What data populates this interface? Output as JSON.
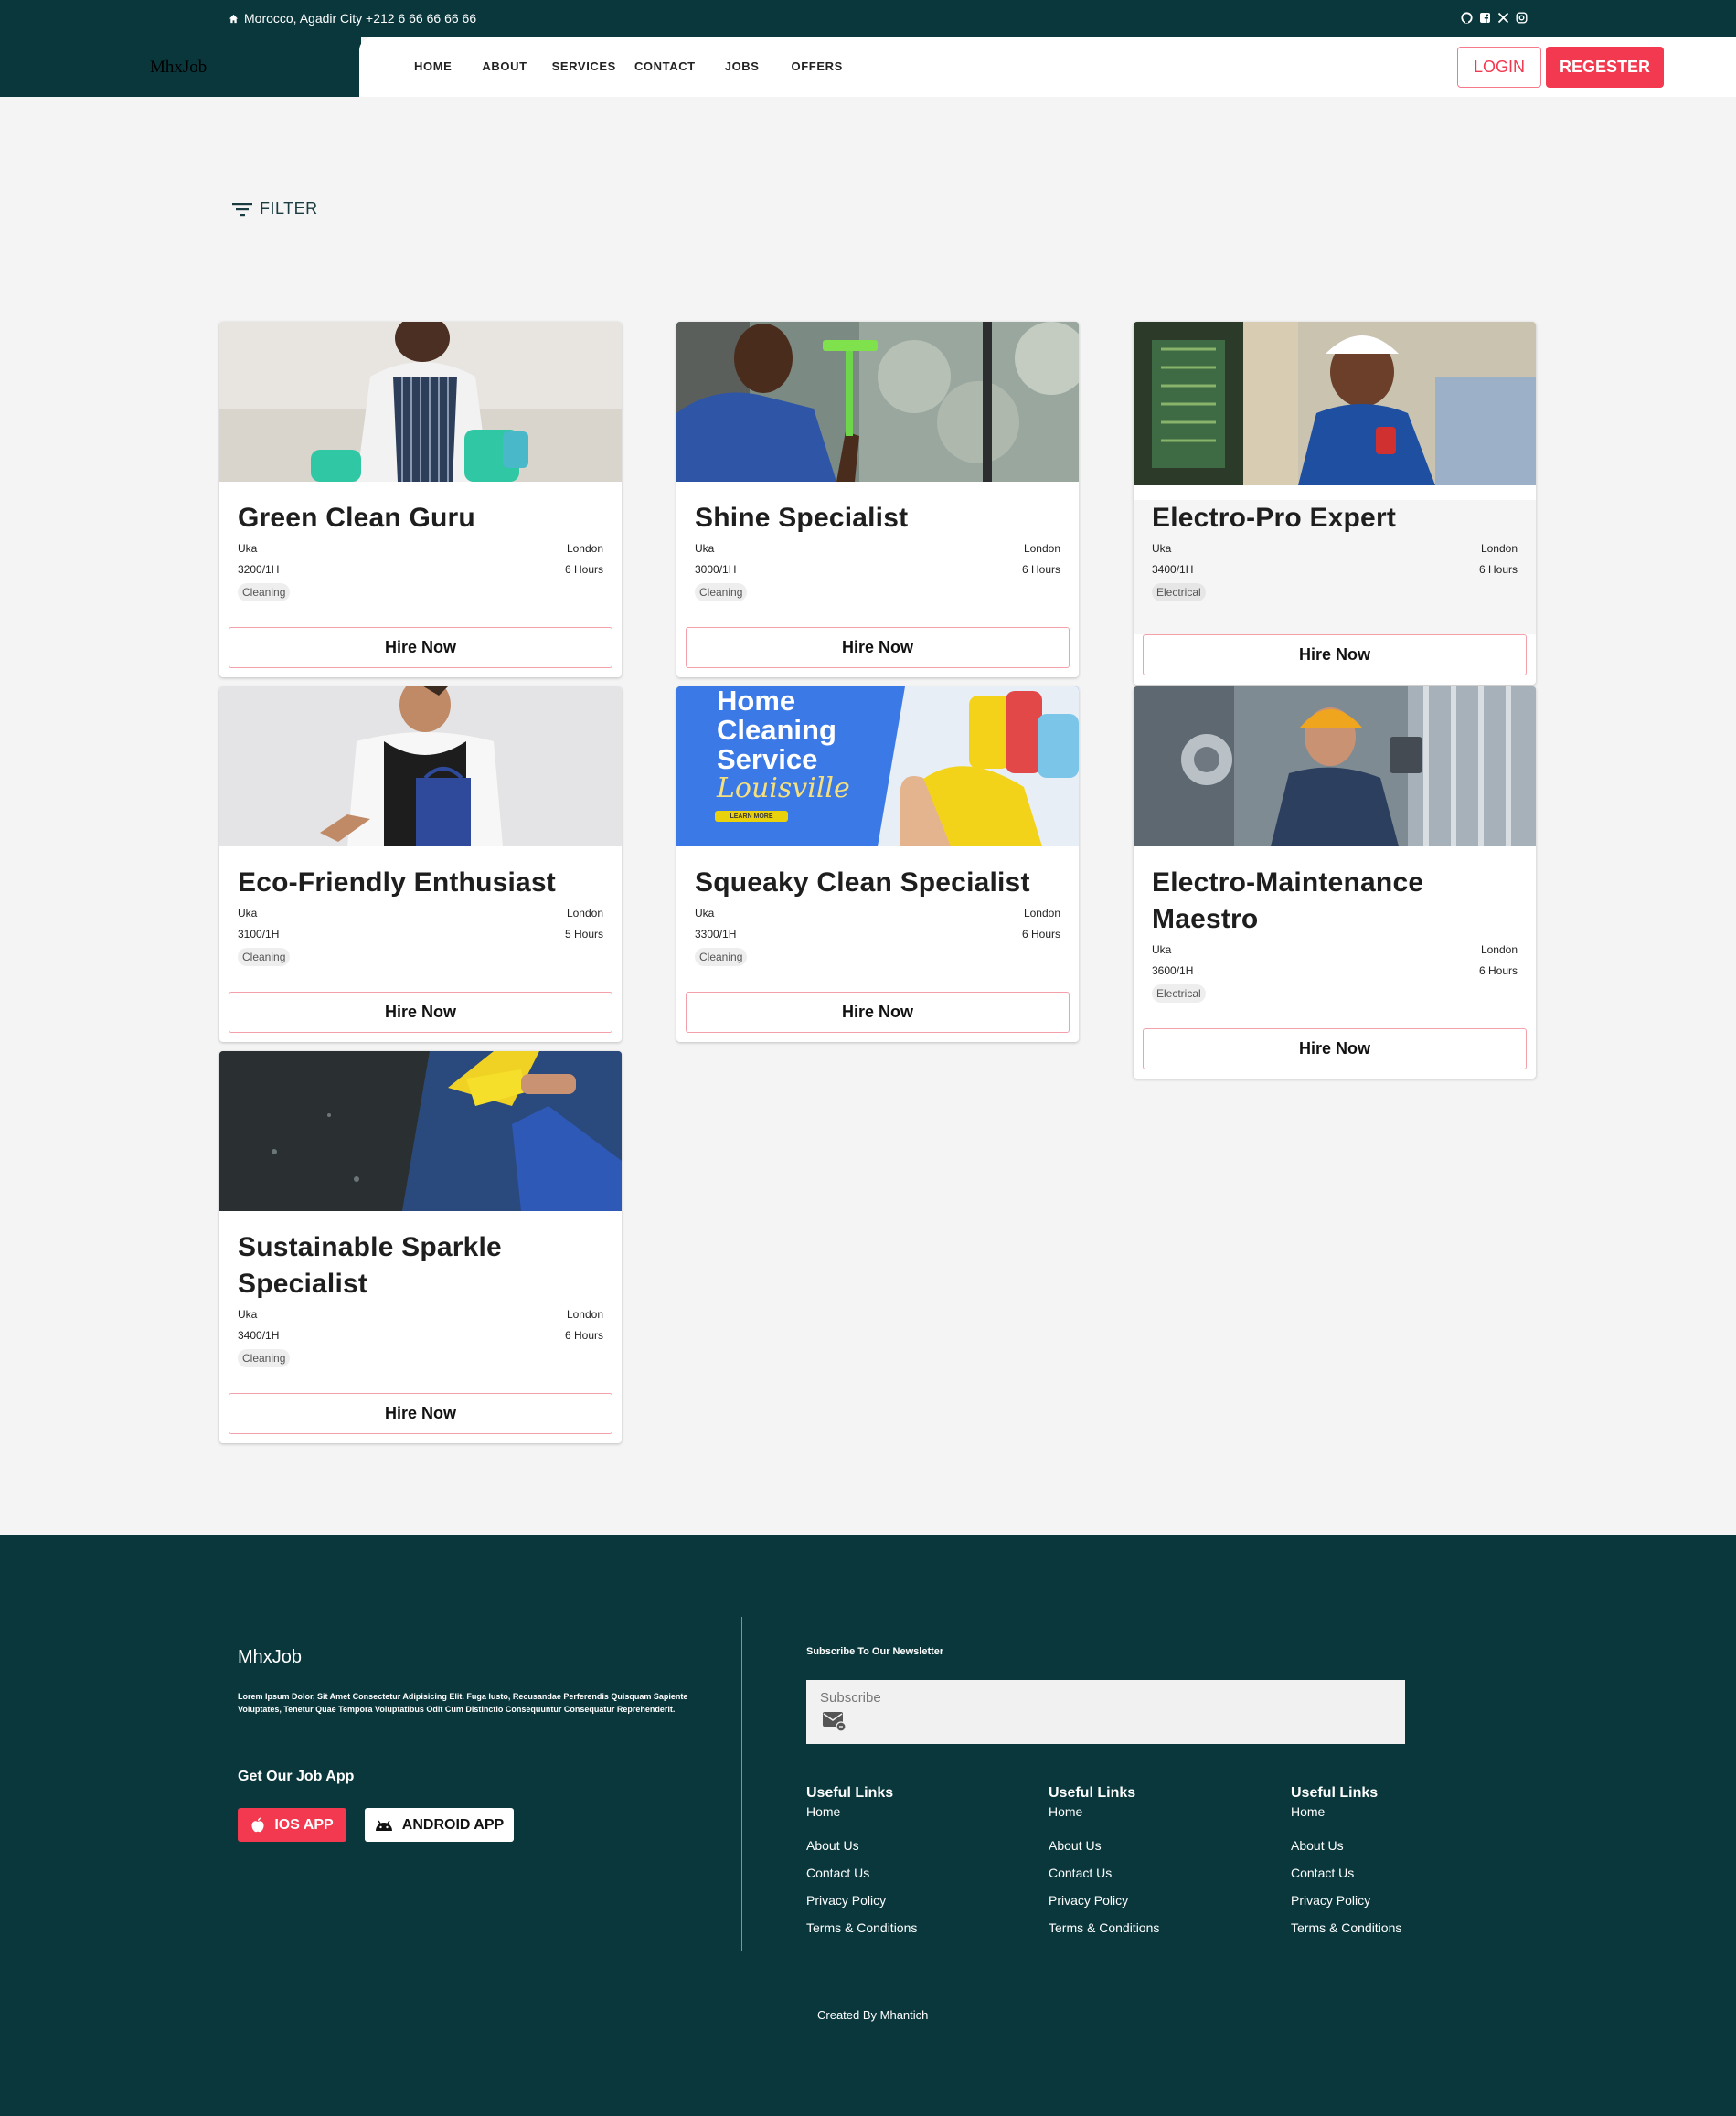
{
  "topbar": {
    "contact": "Morocco, Agadir City +212 6 66 66 66 66",
    "home_icon": "home-icon",
    "social_icons": [
      "github-icon",
      "facebook-icon",
      "x-icon",
      "instagram-icon"
    ]
  },
  "brand": "MhxJob",
  "nav": [
    "HOME",
    "ABOUT",
    "SERVICES",
    "CONTACT",
    "JOBS",
    "OFFERS"
  ],
  "auth": {
    "login": "LOGIN",
    "register": "REGESTER"
  },
  "filter": {
    "label": "FILTER",
    "icon": "filter-icon"
  },
  "cards": [
    {
      "title": "Green Clean Guru",
      "company": "Uka",
      "location": "London",
      "rate": "3200/1H",
      "hours": "6 Hours",
      "tag": "Cleaning",
      "button": "Hire Now"
    },
    {
      "title": "Shine Specialist",
      "company": "Uka",
      "location": "London",
      "rate": "3000/1H",
      "hours": "6 Hours",
      "tag": "Cleaning",
      "button": "Hire Now"
    },
    {
      "title": "Electro-Pro Expert",
      "company": "Uka",
      "location": "London",
      "rate": "3400/1H",
      "hours": "6 Hours",
      "tag": "Electrical",
      "button": "Hire Now"
    },
    {
      "title": "Eco-Friendly Enthusiast",
      "company": "Uka",
      "location": "London",
      "rate": "3100/1H",
      "hours": "5 Hours",
      "tag": "Cleaning",
      "button": "Hire Now"
    },
    {
      "title": "Squeaky Clean Specialist",
      "company": "Uka",
      "location": "London",
      "rate": "3300/1H",
      "hours": "6 Hours",
      "tag": "Cleaning",
      "button": "Hire Now"
    },
    {
      "title": "Electro-Maintenance Maestro",
      "company": "Uka",
      "location": "London",
      "rate": "3600/1H",
      "hours": "6 Hours",
      "tag": "Electrical",
      "button": "Hire Now"
    },
    {
      "title": "Sustainable Sparkle Specialist",
      "company": "Uka",
      "location": "London",
      "rate": "3400/1H",
      "hours": "6 Hours",
      "tag": "Cleaning",
      "button": "Hire Now"
    }
  ],
  "promo_image": {
    "line1": "Home",
    "line2": "Cleaning",
    "line3": "Service",
    "line4": "Louisville",
    "cta": "LEARN MORE"
  },
  "footer": {
    "brand": "MhxJob",
    "lorem": "Lorem Ipsum Dolor, Sit Amet Consectetur Adipisicing Elit. Fuga Iusto, Recusandae Perferendis Quisquam Sapiente Voluptates, Tenetur Quae Tempora Voluptatibus Odit Cum Distinctio Consequuntur Consequatur Reprehenderit.",
    "app_title": "Get Our Job App",
    "ios": "IOS APP",
    "android": "ANDROID APP",
    "newsletter_title": "Subscribe To Our Newsletter",
    "subscribe_placeholder": "Subscribe",
    "link_columns": [
      {
        "heading": "Useful Links",
        "links": [
          "Home",
          "About Us",
          "Contact Us",
          "Privacy Policy",
          "Terms & Conditions"
        ]
      },
      {
        "heading": "Useful Links",
        "links": [
          "Home",
          "About Us",
          "Contact Us",
          "Privacy Policy",
          "Terms & Conditions"
        ]
      },
      {
        "heading": "Useful Links",
        "links": [
          "Home",
          "About Us",
          "Contact Us",
          "Privacy Policy",
          "Terms & Conditions"
        ]
      }
    ],
    "credit": "Created By Mhantich"
  },
  "colors": {
    "dark_teal": "#09373c",
    "accent_red": "#f2394f",
    "page_bg": "#f4f4f4"
  }
}
